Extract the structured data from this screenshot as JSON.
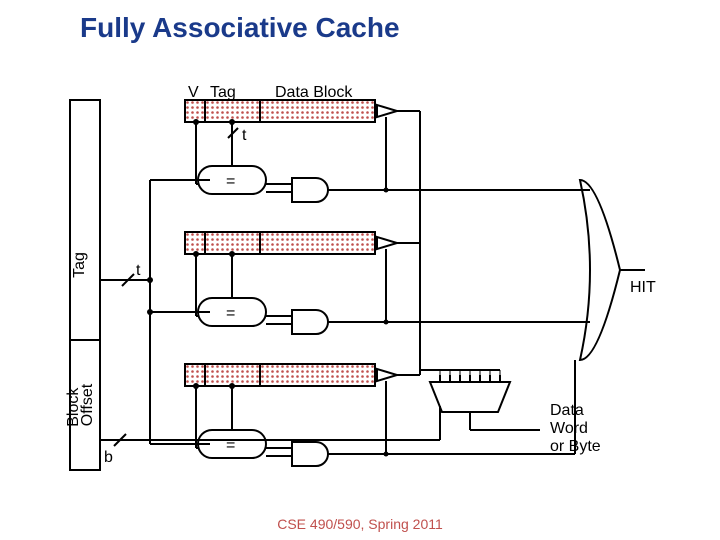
{
  "title": "Fully Associative Cache",
  "footer": "CSE 490/590, Spring 2011",
  "labels": {
    "v": "V",
    "tag": "Tag",
    "data": "Data Block",
    "t1": "t",
    "t2": "t",
    "b": "b",
    "hit": "HIT",
    "dataword": "Data\nWord\nor Byte",
    "eq1": "=",
    "eq2": "=",
    "eq3": "=",
    "sidebar_tag": "Tag",
    "sidebar_bo": "Block\nOffset"
  }
}
